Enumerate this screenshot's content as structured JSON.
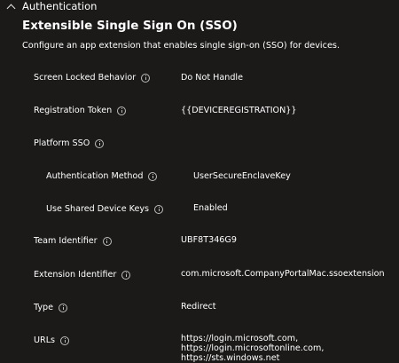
{
  "section": {
    "label": "Authentication"
  },
  "title": "Extensible Single Sign On (SSO)",
  "description": "Configure an app extension that enables single sign-on (SSO) for devices.",
  "settings": [
    {
      "label": "Screen Locked Behavior",
      "value": "Do Not Handle"
    },
    {
      "label": "Registration Token",
      "value": "{{DEVICEREGISTRATION}}"
    },
    {
      "label": "Platform SSO",
      "value": ""
    },
    {
      "label": "Authentication Method",
      "value": "UserSecureEnclaveKey"
    },
    {
      "label": "Use Shared Device Keys",
      "value": "Enabled"
    },
    {
      "label": "Team Identifier",
      "value": "UBF8T346G9"
    },
    {
      "label": "Extension Identifier",
      "value": "com.microsoft.CompanyPortalMac.ssoextension"
    },
    {
      "label": "Type",
      "value": "Redirect"
    },
    {
      "label": "URLs",
      "value": "https://login.microsoft.com, https://login.microsoftonline.com, https://sts.windows.net"
    }
  ],
  "icons": {
    "section_toggle": "chevron-up-icon",
    "info": "info-icon"
  }
}
